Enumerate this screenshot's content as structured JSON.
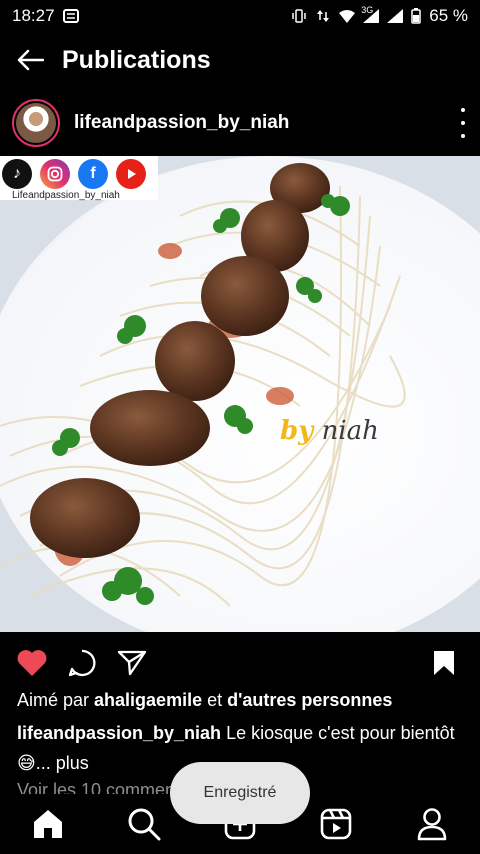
{
  "status_bar": {
    "time": "18:27",
    "network": "3G",
    "battery": "65 %",
    "icons": [
      "message-icon",
      "vibrate-icon",
      "data-transfer-icon",
      "wifi-icon",
      "signal-icon",
      "signal-icon",
      "battery-icon"
    ]
  },
  "header": {
    "title": "Publications",
    "back_icon": "back-arrow-icon"
  },
  "post": {
    "username": "lifeandpassion_by_niah",
    "image": {
      "overlay_caption": "Lifeandpassion_by_niah",
      "social_icons": [
        "tiktok-icon",
        "instagram-icon",
        "facebook-icon",
        "youtube-icon"
      ],
      "watermark_by": "by",
      "watermark_name": "niah"
    },
    "liked": true,
    "saved": true
  },
  "likes": {
    "prefix": "Aimé par ",
    "user": "ahaligaemile",
    "middle": " et ",
    "others": "d'autres personnes"
  },
  "caption": {
    "user": "lifeandpassion_by_niah",
    "text": " Le kiosque c'est pour bientôt ",
    "emoji": "😅",
    "more": "... plus"
  },
  "comments_link": "Voir les 10 commentaires",
  "toast": "Enregistré",
  "bottom_nav": [
    "home-icon",
    "search-icon",
    "add-post-icon",
    "reels-icon",
    "profile-icon"
  ]
}
